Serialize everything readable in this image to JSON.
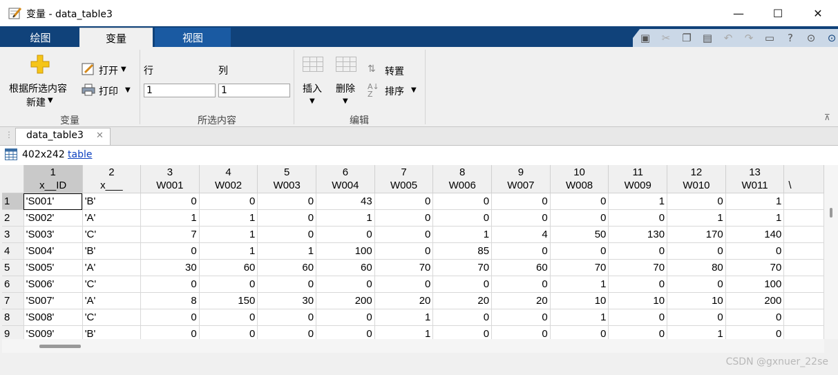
{
  "window": {
    "title": "变量 - data_table3",
    "minimize": "—",
    "maximize": "☐",
    "close": "✕"
  },
  "tabs": [
    {
      "label": "绘图",
      "active": false
    },
    {
      "label": "变量",
      "active": true
    },
    {
      "label": "视图",
      "active": false
    }
  ],
  "quick_access": [
    "save-icon",
    "cut-icon",
    "copy-icon",
    "paste-icon",
    "undo-icon",
    "redo-icon",
    "window-icon",
    "help-icon",
    "options-icon",
    "expand-icon"
  ],
  "ribbon": {
    "variable_group": {
      "new_line1": "根据所选内容",
      "new_line2": "新建",
      "open": "打开",
      "print": "打印",
      "label": "变量"
    },
    "selection_group": {
      "row_label": "行",
      "col_label": "列",
      "row_value": "1",
      "col_value": "1",
      "label": "所选内容"
    },
    "edit_group": {
      "insert": "插入",
      "delete": "删除",
      "transpose": "转置",
      "sort": "排序",
      "label": "编辑"
    }
  },
  "doc_tab": {
    "label": "data_table3",
    "close": "✕"
  },
  "info": {
    "size": "402x242",
    "type_link": "table"
  },
  "table": {
    "col_numbers": [
      "1",
      "2",
      "3",
      "4",
      "5",
      "6",
      "7",
      "8",
      "9",
      "10",
      "11",
      "12",
      "13"
    ],
    "col_names": [
      "x__ID",
      "x___",
      "W001",
      "W002",
      "W003",
      "W004",
      "W005",
      "W006",
      "W007",
      "W008",
      "W009",
      "W010",
      "W011"
    ],
    "partial_col_name": "\\",
    "rows": [
      {
        "n": "1",
        "cells": [
          "'S001'",
          "'B'",
          "0",
          "0",
          "0",
          "43",
          "0",
          "0",
          "0",
          "0",
          "1",
          "0",
          "1"
        ]
      },
      {
        "n": "2",
        "cells": [
          "'S002'",
          "'A'",
          "1",
          "1",
          "0",
          "1",
          "0",
          "0",
          "0",
          "0",
          "0",
          "1",
          "1"
        ]
      },
      {
        "n": "3",
        "cells": [
          "'S003'",
          "'C'",
          "7",
          "1",
          "0",
          "0",
          "0",
          "1",
          "4",
          "50",
          "130",
          "170",
          "140"
        ]
      },
      {
        "n": "4",
        "cells": [
          "'S004'",
          "'B'",
          "0",
          "1",
          "1",
          "100",
          "0",
          "85",
          "0",
          "0",
          "0",
          "0",
          "0"
        ]
      },
      {
        "n": "5",
        "cells": [
          "'S005'",
          "'A'",
          "30",
          "60",
          "60",
          "60",
          "70",
          "70",
          "60",
          "70",
          "70",
          "80",
          "70"
        ]
      },
      {
        "n": "6",
        "cells": [
          "'S006'",
          "'C'",
          "0",
          "0",
          "0",
          "0",
          "0",
          "0",
          "0",
          "1",
          "0",
          "0",
          "100"
        ]
      },
      {
        "n": "7",
        "cells": [
          "'S007'",
          "'A'",
          "8",
          "150",
          "30",
          "200",
          "20",
          "20",
          "20",
          "10",
          "10",
          "10",
          "200"
        ]
      },
      {
        "n": "8",
        "cells": [
          "'S008'",
          "'C'",
          "0",
          "0",
          "0",
          "0",
          "1",
          "0",
          "0",
          "1",
          "0",
          "0",
          "0"
        ]
      },
      {
        "n": "9",
        "cells": [
          "'S009'",
          "'B'",
          "0",
          "0",
          "0",
          "0",
          "1",
          "0",
          "0",
          "0",
          "0",
          "1",
          "0"
        ]
      }
    ]
  },
  "watermark": "CSDN @gxnuer_22se"
}
